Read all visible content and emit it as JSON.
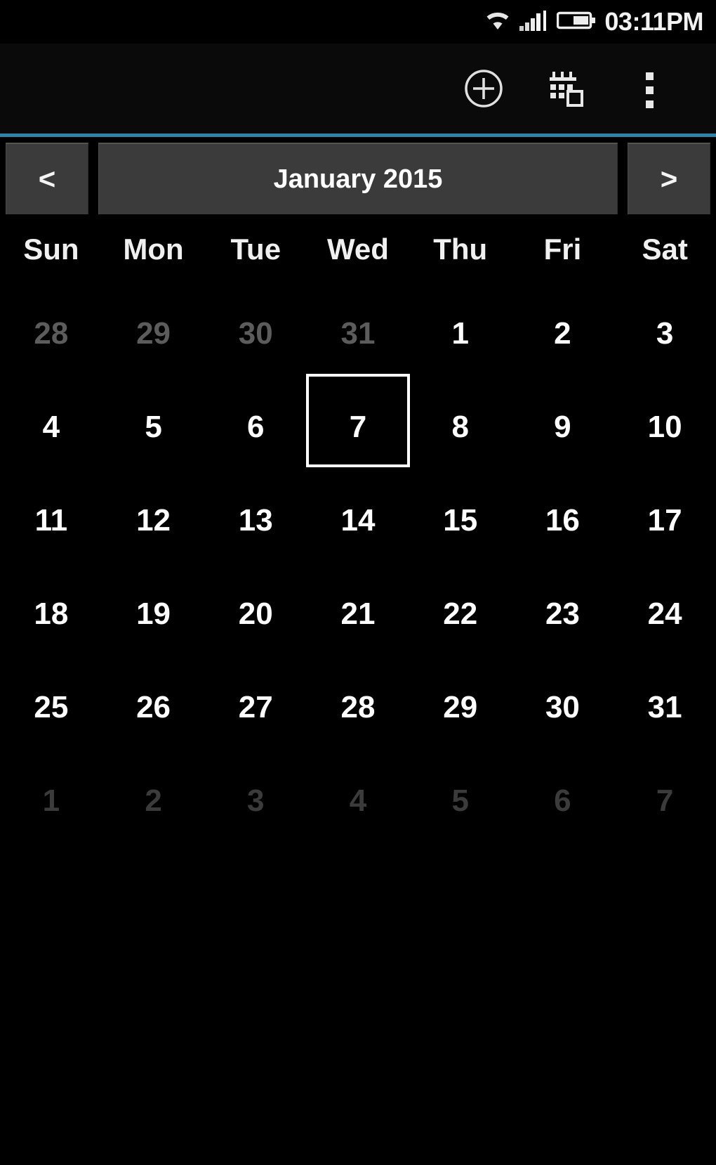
{
  "status_bar": {
    "time": "03:11PM",
    "icons": [
      "wifi-icon",
      "signal-icon",
      "battery-icon"
    ]
  },
  "action_bar": {
    "items": [
      {
        "name": "add-event-button",
        "icon": "plus-circle-icon",
        "label": "Add"
      },
      {
        "name": "go-to-today-button",
        "icon": "calendar-today-icon",
        "label": "Today"
      },
      {
        "name": "overflow-menu-button",
        "icon": "overflow-menu-icon",
        "label": "More options"
      }
    ],
    "accent_color": "#2d84a8"
  },
  "month_nav": {
    "prev_label": "<",
    "next_label": ">",
    "title": "January 2015"
  },
  "weekdays": [
    "Sun",
    "Mon",
    "Tue",
    "Wed",
    "Thu",
    "Fri",
    "Sat"
  ],
  "calendar": {
    "selected_day": 7,
    "weeks": [
      [
        {
          "num": "28",
          "type": "prev"
        },
        {
          "num": "29",
          "type": "prev"
        },
        {
          "num": "30",
          "type": "prev"
        },
        {
          "num": "31",
          "type": "prev"
        },
        {
          "num": "1",
          "type": "current"
        },
        {
          "num": "2",
          "type": "current"
        },
        {
          "num": "3",
          "type": "current"
        }
      ],
      [
        {
          "num": "4",
          "type": "current"
        },
        {
          "num": "5",
          "type": "current"
        },
        {
          "num": "6",
          "type": "current"
        },
        {
          "num": "7",
          "type": "current",
          "selected": true
        },
        {
          "num": "8",
          "type": "current"
        },
        {
          "num": "9",
          "type": "current"
        },
        {
          "num": "10",
          "type": "current"
        }
      ],
      [
        {
          "num": "11",
          "type": "current"
        },
        {
          "num": "12",
          "type": "current"
        },
        {
          "num": "13",
          "type": "current"
        },
        {
          "num": "14",
          "type": "current"
        },
        {
          "num": "15",
          "type": "current"
        },
        {
          "num": "16",
          "type": "current"
        },
        {
          "num": "17",
          "type": "current"
        }
      ],
      [
        {
          "num": "18",
          "type": "current"
        },
        {
          "num": "19",
          "type": "current"
        },
        {
          "num": "20",
          "type": "current"
        },
        {
          "num": "21",
          "type": "current"
        },
        {
          "num": "22",
          "type": "current"
        },
        {
          "num": "23",
          "type": "current"
        },
        {
          "num": "24",
          "type": "current"
        }
      ],
      [
        {
          "num": "25",
          "type": "current"
        },
        {
          "num": "26",
          "type": "current"
        },
        {
          "num": "27",
          "type": "current"
        },
        {
          "num": "28",
          "type": "current"
        },
        {
          "num": "29",
          "type": "current"
        },
        {
          "num": "30",
          "type": "current"
        },
        {
          "num": "31",
          "type": "current"
        }
      ],
      [
        {
          "num": "1",
          "type": "next"
        },
        {
          "num": "2",
          "type": "next"
        },
        {
          "num": "3",
          "type": "next"
        },
        {
          "num": "4",
          "type": "next"
        },
        {
          "num": "5",
          "type": "next"
        },
        {
          "num": "6",
          "type": "next"
        },
        {
          "num": "7",
          "type": "next"
        }
      ]
    ]
  },
  "colors": {
    "background": "#000000",
    "accent": "#2d84a8",
    "button_face": "#3b3b3b",
    "prev_month_text": "#5c5c5c",
    "next_month_text": "#3b3b3b"
  }
}
